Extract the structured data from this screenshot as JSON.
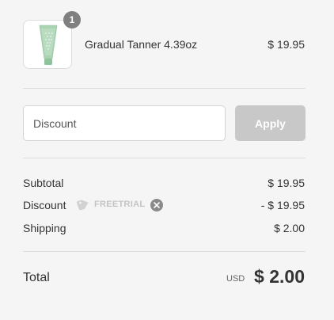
{
  "product": {
    "quantity": "1",
    "name": "Gradual Tanner 4.39oz",
    "price": "$ 19.95"
  },
  "discount_form": {
    "placeholder": "Discount",
    "apply_label": "Apply"
  },
  "summary": {
    "subtotal_label": "Subtotal",
    "subtotal_value": "$ 19.95",
    "discount_label": "Discount",
    "discount_code": "FREETRIAL",
    "discount_value": "- $ 19.95",
    "shipping_label": "Shipping",
    "shipping_value": "$ 2.00"
  },
  "total": {
    "label": "Total",
    "currency": "USD",
    "amount": "$ 2.00"
  },
  "icons": {
    "tag": "tag-icon",
    "remove": "close-icon"
  },
  "colors": {
    "apply_button_bg": "#c8c8c8",
    "badge_bg": "#7f7f7f",
    "tube_green": "#9dc9a7"
  }
}
